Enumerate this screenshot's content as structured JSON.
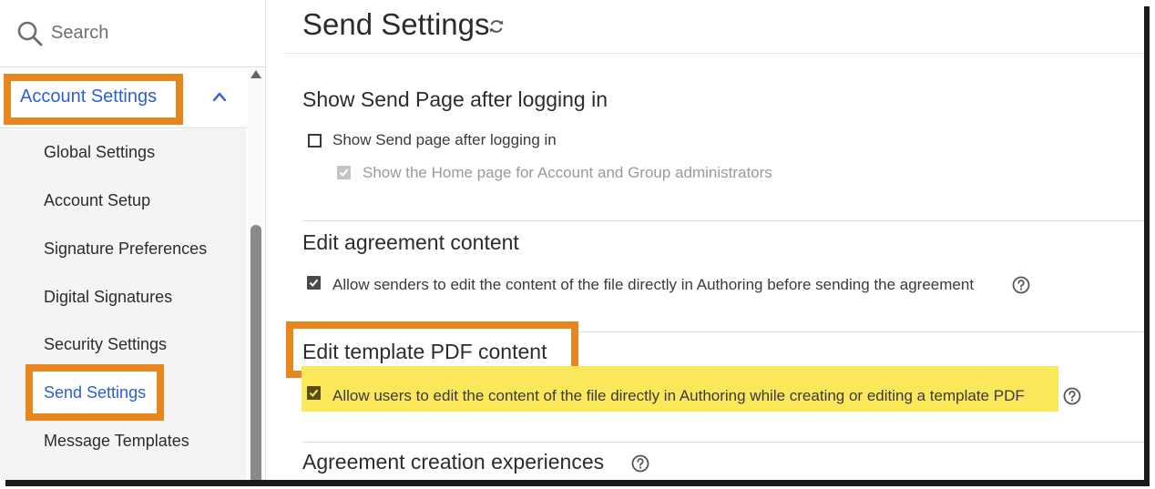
{
  "search": {
    "placeholder": "Search"
  },
  "sidebar": {
    "header_label": "Account Settings",
    "items": [
      {
        "label": "Global Settings"
      },
      {
        "label": "Account Setup"
      },
      {
        "label": "Signature Preferences"
      },
      {
        "label": "Digital Signatures"
      },
      {
        "label": "Security Settings"
      },
      {
        "label": "Send Settings",
        "active": true
      },
      {
        "label": "Message Templates"
      }
    ]
  },
  "main": {
    "title": "Send Settings",
    "sections": [
      {
        "heading": "Show Send Page after logging in",
        "options": [
          {
            "label": "Show Send page after logging in",
            "checked": false,
            "disabled": false
          },
          {
            "label": "Show the Home page for Account and Group administrators",
            "checked": true,
            "disabled": true
          }
        ]
      },
      {
        "heading": "Edit agreement content",
        "options": [
          {
            "label": "Allow senders to edit the content of the file directly in Authoring before sending the agreement",
            "checked": true,
            "help": true
          }
        ]
      },
      {
        "heading": "Edit template PDF content",
        "options": [
          {
            "label": "Allow users to edit the content of the file directly in Authoring while creating or editing a template PDF",
            "checked": true,
            "help": true
          }
        ]
      },
      {
        "heading": "Agreement creation experiences",
        "help": true
      }
    ]
  },
  "colors": {
    "accent_blue": "#2d5dd7",
    "annotation_orange": "#e8861e",
    "annotation_yellow": "#fbe85a",
    "text": "#2c2c2c",
    "disabled": "#9a9a9a"
  },
  "icons": {
    "search": "magnifier-icon",
    "collapse": "chevron-up-icon",
    "refresh": "refresh-icon",
    "help": "question-circle-icon",
    "checkbox_checked": "checkmark-checkbox",
    "checkbox_unchecked": "empty-checkbox"
  }
}
